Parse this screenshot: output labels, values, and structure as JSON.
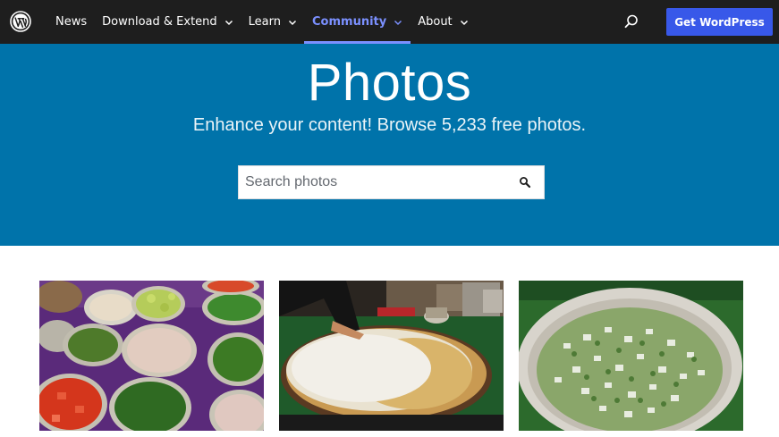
{
  "nav": {
    "logo": "wordpress-logo",
    "items": [
      {
        "label": "News",
        "has_dropdown": false
      },
      {
        "label": "Download & Extend",
        "has_dropdown": true
      },
      {
        "label": "Learn",
        "has_dropdown": true
      },
      {
        "label": "Community",
        "has_dropdown": true,
        "active": true
      },
      {
        "label": "About",
        "has_dropdown": true
      }
    ],
    "search_icon": "search-icon",
    "cta_label": "Get WordPress"
  },
  "hero": {
    "title": "Photos",
    "subtitle": "Enhance your content! Browse 5,233 free photos.",
    "search_placeholder": "Search photos",
    "search_value": ""
  },
  "photos": [
    {
      "subject": "bowls of chopped vegetables and chutneys on purple cloth"
    },
    {
      "subject": "large dosa being cooked on a round griddle"
    },
    {
      "subject": "plate of chopped green onions and white pieces"
    }
  ],
  "colors": {
    "topbar_bg": "#1e1e1e",
    "accent_active": "#7b90ff",
    "cta_bg": "#3858e9",
    "hero_bg": "#0073aa"
  }
}
